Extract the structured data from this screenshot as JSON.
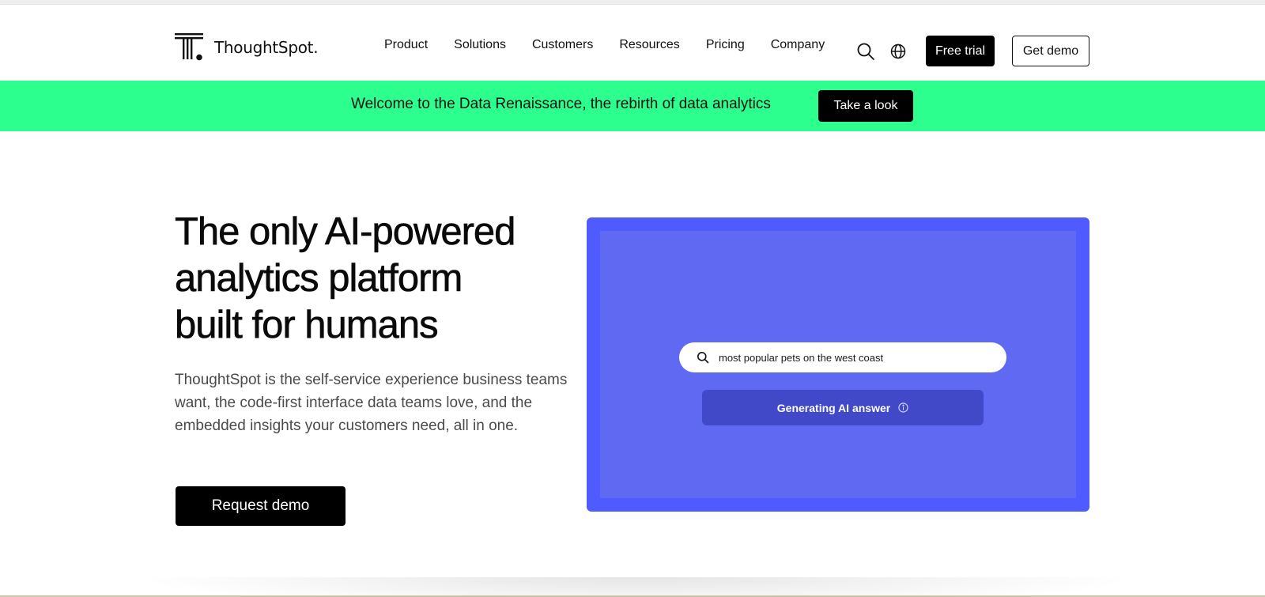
{
  "brand": {
    "name": "ThoughtSpot",
    "dot": ".",
    "accent_color": "#2cff8e",
    "panel_color": "#4f5aff"
  },
  "nav": {
    "items": [
      {
        "label": "Product"
      },
      {
        "label": "Solutions"
      },
      {
        "label": "Customers"
      },
      {
        "label": "Resources"
      },
      {
        "label": "Pricing"
      },
      {
        "label": "Company"
      }
    ],
    "icons": [
      "search-icon",
      "globe-icon"
    ],
    "free_trial": "Free trial",
    "get_demo": "Get demo"
  },
  "banner": {
    "text": "Welcome to the Data Renaissance, the rebirth of data analytics",
    "button": "Take a look"
  },
  "hero": {
    "title_lines": [
      "The only AI-powered",
      "analytics platform",
      "built for humans"
    ],
    "description": "ThoughtSpot is the self-service experience business teams want, the code-first interface data teams love, and the embedded insights your customers need, all in one.",
    "cta": "Request demo"
  },
  "demo_panel": {
    "search_query": "most popular pets on the west coast",
    "status": "Generating AI answer"
  }
}
